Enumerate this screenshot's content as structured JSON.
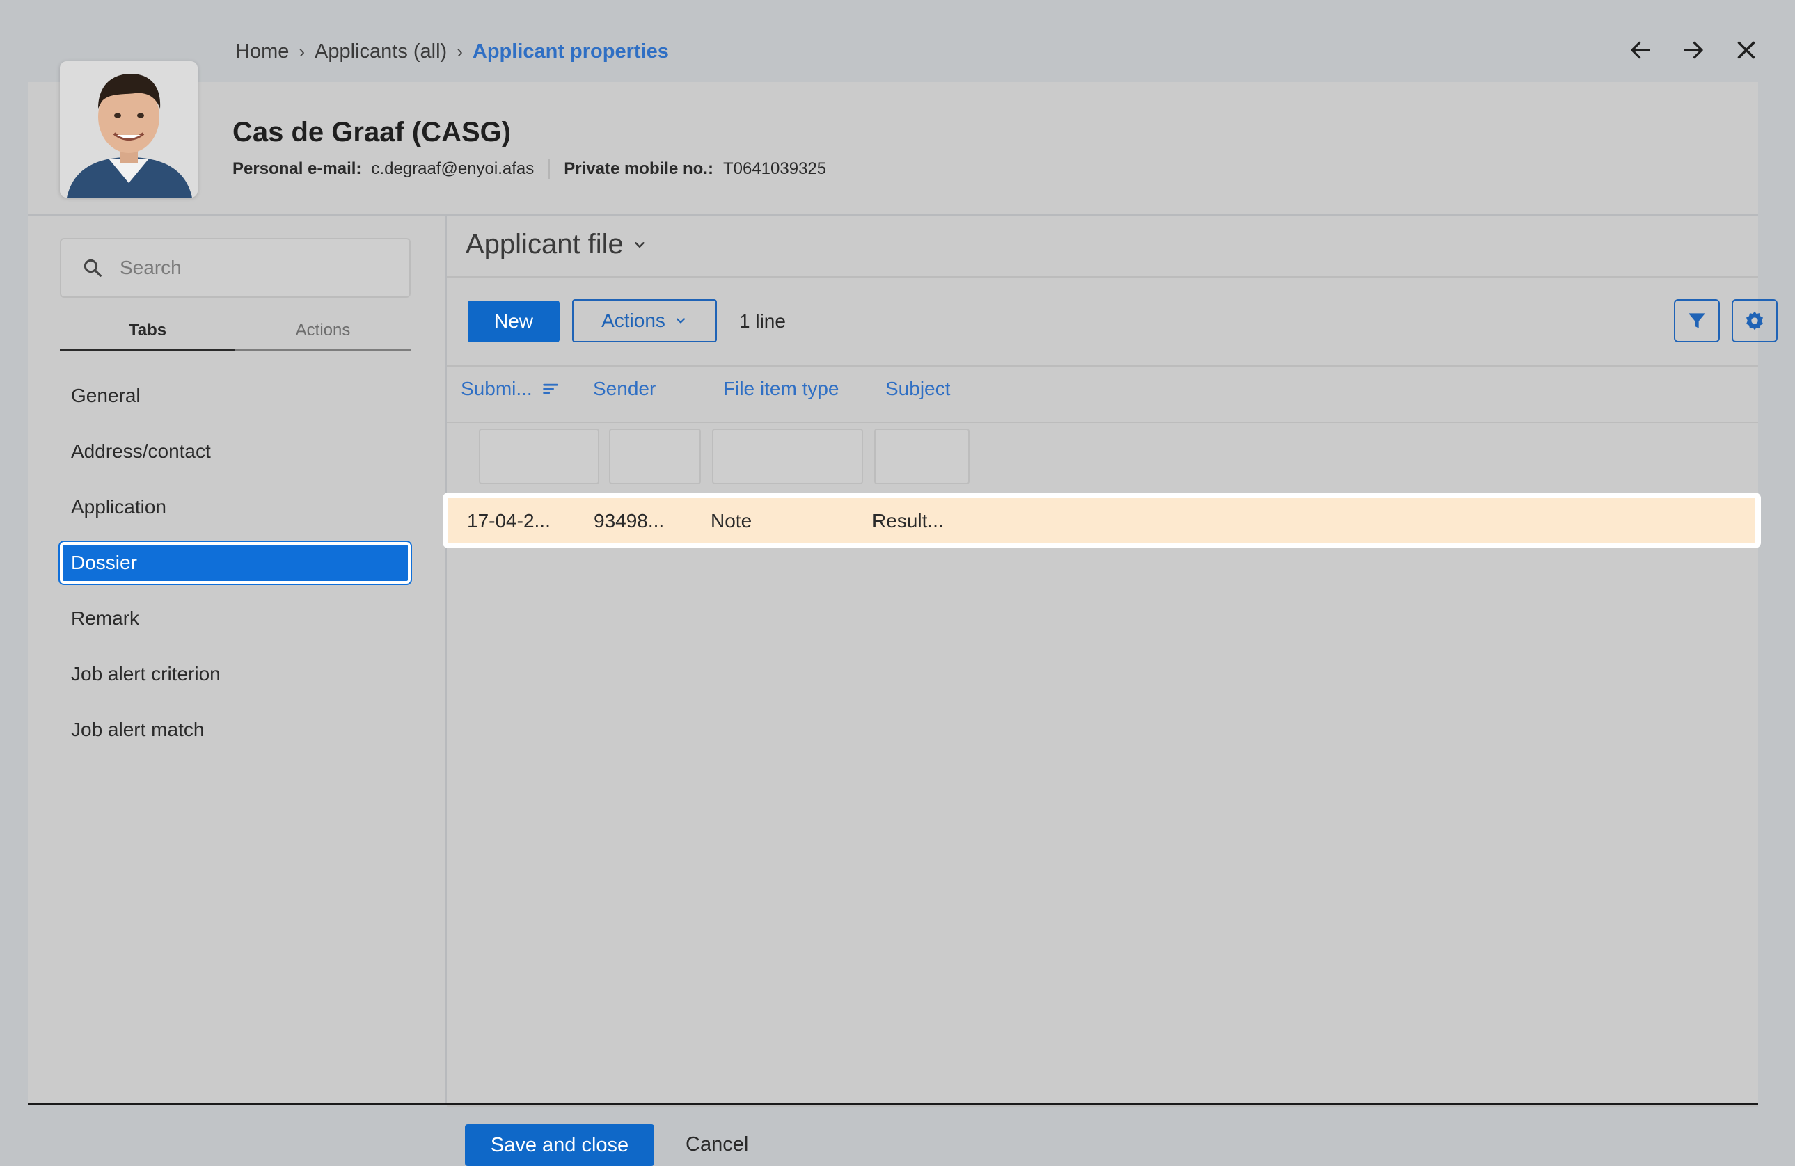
{
  "breadcrumb": {
    "items": [
      "Home",
      "Applicants (all)"
    ],
    "current": "Applicant properties"
  },
  "window_controls": {
    "back_icon": "arrow-left-icon",
    "forward_icon": "arrow-right-icon",
    "close_icon": "close-icon"
  },
  "profile": {
    "name": "Cas de Graaf (CASG)",
    "email_label": "Personal e-mail:",
    "email_value": "c.degraaf@enyoi.afas",
    "mobile_label": "Private mobile no.:",
    "mobile_value": "T0641039325"
  },
  "sidebar": {
    "search_placeholder": "Search",
    "tabs": [
      "Tabs",
      "Actions"
    ],
    "active_tab": "Tabs",
    "items": [
      "General",
      "Address/contact",
      "Application",
      "Dossier",
      "Remark",
      "Job alert criterion",
      "Job alert match"
    ],
    "selected_item": "Dossier"
  },
  "main": {
    "title": "Applicant file",
    "toolbar": {
      "new_label": "New",
      "actions_label": "Actions",
      "line_count": "1 line"
    },
    "columns": [
      "Submi...",
      "Sender",
      "File item type",
      "Subject"
    ],
    "rows": [
      [
        "17-04-2...",
        "93498...",
        "Note",
        "Result..."
      ]
    ]
  },
  "footer": {
    "save_label": "Save and close",
    "cancel_label": "Cancel"
  },
  "colors": {
    "primary": "#0f68c8",
    "link": "#2f6fc4",
    "selected_row": "#fde9cf",
    "background": "#c1c4c7"
  }
}
